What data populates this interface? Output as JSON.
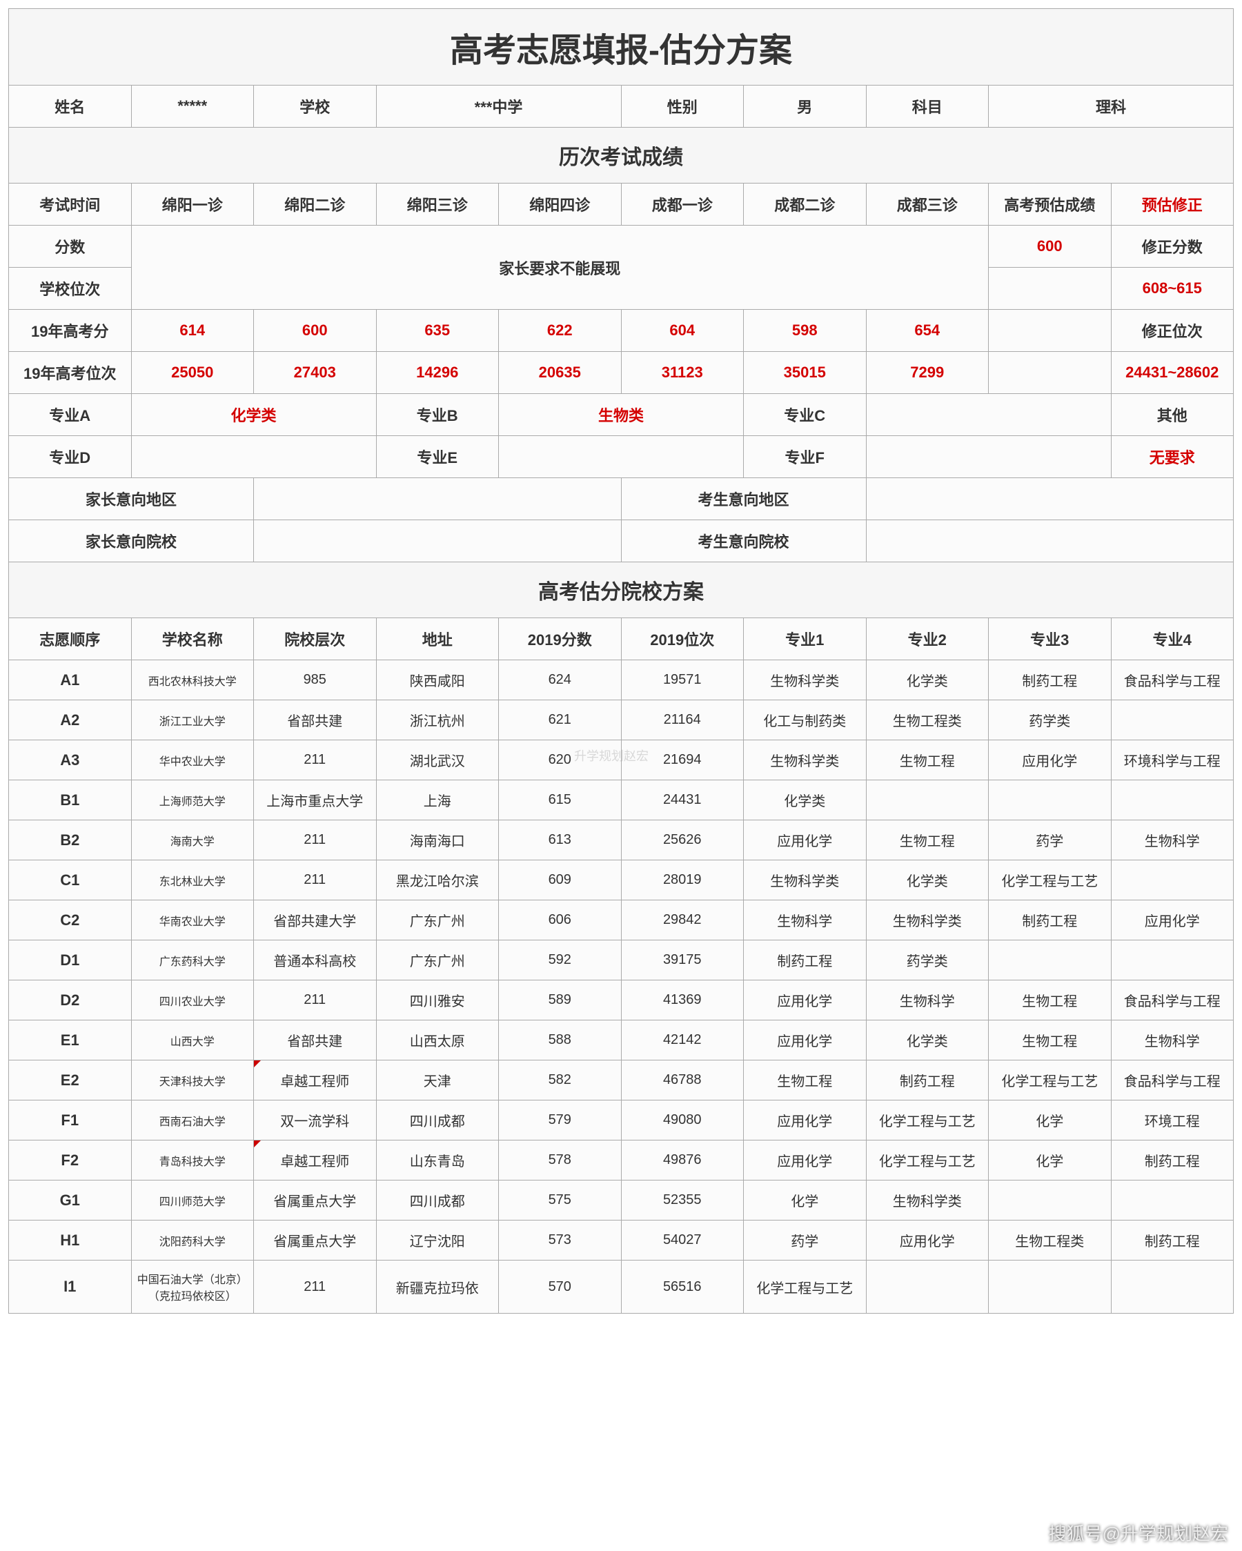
{
  "title": "高考志愿填报-估分方案",
  "student": {
    "name_label": "姓名",
    "name": "*****",
    "school_label": "学校",
    "school": "***中学",
    "gender_label": "性别",
    "gender": "男",
    "subject_label": "科目",
    "subject": "理科"
  },
  "exam_section": "历次考试成绩",
  "exam_headers": {
    "time": "考试时间",
    "cols": [
      "绵阳一诊",
      "绵阳二诊",
      "绵阳三诊",
      "绵阳四诊",
      "成都一诊",
      "成都二诊",
      "成都三诊"
    ],
    "pred": "高考预估成绩",
    "correction": "预估修正"
  },
  "score_label": "分数",
  "rank_label": "学校位次",
  "parent_hidden": "家长要求不能展现",
  "pred_score": "600",
  "corr_score_label": "修正分数",
  "corr_score": "608~615",
  "gk_score_label": "19年高考分",
  "gk_scores": [
    "614",
    "600",
    "635",
    "622",
    "604",
    "598",
    "654"
  ],
  "gk_score_blank": "",
  "corr_rank_label": "修正位次",
  "gk_rank_label": "19年高考位次",
  "gk_ranks": [
    "25050",
    "27403",
    "14296",
    "20635",
    "31123",
    "35015",
    "7299"
  ],
  "gk_rank_blank": "",
  "corr_rank": "24431~28602",
  "major_labels": {
    "A": "专业A",
    "B": "专业B",
    "C": "专业C",
    "D": "专业D",
    "E": "专业E",
    "F": "专业F",
    "other": "其他",
    "none": "无要求"
  },
  "major_A": "化学类",
  "major_B": "生物类",
  "major_C": "",
  "major_D": "",
  "major_E": "",
  "major_F": "",
  "intent_labels": {
    "parent_area": "家长意向地区",
    "student_area": "考生意向地区",
    "parent_school": "家长意向院校",
    "student_school": "考生意向院校"
  },
  "plan_section": "高考估分院校方案",
  "plan_headers": [
    "志愿顺序",
    "学校名称",
    "院校层次",
    "地址",
    "2019分数",
    "2019位次",
    "专业1",
    "专业2",
    "专业3",
    "专业4"
  ],
  "chart_data": {
    "type": "table",
    "columns": [
      "志愿顺序",
      "学校名称",
      "院校层次",
      "地址",
      "2019分数",
      "2019位次",
      "专业1",
      "专业2",
      "专业3",
      "专业4"
    ],
    "rows": [
      [
        "A1",
        "西北农林科技大学",
        "985",
        "陕西咸阳",
        "624",
        "19571",
        "生物科学类",
        "化学类",
        "制药工程",
        "食品科学与工程"
      ],
      [
        "A2",
        "浙江工业大学",
        "省部共建",
        "浙江杭州",
        "621",
        "21164",
        "化工与制药类",
        "生物工程类",
        "药学类",
        ""
      ],
      [
        "A3",
        "华中农业大学",
        "211",
        "湖北武汉",
        "620",
        "21694",
        "生物科学类",
        "生物工程",
        "应用化学",
        "环境科学与工程"
      ],
      [
        "B1",
        "上海师范大学",
        "上海市重点大学",
        "上海",
        "615",
        "24431",
        "化学类",
        "",
        "",
        ""
      ],
      [
        "B2",
        "海南大学",
        "211",
        "海南海口",
        "613",
        "25626",
        "应用化学",
        "生物工程",
        "药学",
        "生物科学"
      ],
      [
        "C1",
        "东北林业大学",
        "211",
        "黑龙江哈尔滨",
        "609",
        "28019",
        "生物科学类",
        "化学类",
        "化学工程与工艺",
        ""
      ],
      [
        "C2",
        "华南农业大学",
        "省部共建大学",
        "广东广州",
        "606",
        "29842",
        "生物科学",
        "生物科学类",
        "制药工程",
        "应用化学"
      ],
      [
        "D1",
        "广东药科大学",
        "普通本科高校",
        "广东广州",
        "592",
        "39175",
        "制药工程",
        "药学类",
        "",
        ""
      ],
      [
        "D2",
        "四川农业大学",
        "211",
        "四川雅安",
        "589",
        "41369",
        "应用化学",
        "生物科学",
        "生物工程",
        "食品科学与工程"
      ],
      [
        "E1",
        "山西大学",
        "省部共建",
        "山西太原",
        "588",
        "42142",
        "应用化学",
        "化学类",
        "生物工程",
        "生物科学"
      ],
      [
        "E2",
        "天津科技大学",
        "卓越工程师",
        "天津",
        "582",
        "46788",
        "生物工程",
        "制药工程",
        "化学工程与工艺",
        "食品科学与工程"
      ],
      [
        "F1",
        "西南石油大学",
        "双一流学科",
        "四川成都",
        "579",
        "49080",
        "应用化学",
        "化学工程与工艺",
        "化学",
        "环境工程"
      ],
      [
        "F2",
        "青岛科技大学",
        "卓越工程师",
        "山东青岛",
        "578",
        "49876",
        "应用化学",
        "化学工程与工艺",
        "化学",
        "制药工程"
      ],
      [
        "G1",
        "四川师范大学",
        "省属重点大学",
        "四川成都",
        "575",
        "52355",
        "化学",
        "生物科学类",
        "",
        ""
      ],
      [
        "H1",
        "沈阳药科大学",
        "省属重点大学",
        "辽宁沈阳",
        "573",
        "54027",
        "药学",
        "应用化学",
        "生物工程类",
        "制药工程"
      ],
      [
        "I1",
        "中国石油大学（北京）（克拉玛依校区）",
        "211",
        "新疆克拉玛依",
        "570",
        "56516",
        "化学工程与工艺",
        "",
        "",
        ""
      ]
    ],
    "tri_rows": [
      10,
      12
    ]
  },
  "watermark": "升学规划赵宏",
  "footer": "搜狐号@升学规划赵宏"
}
